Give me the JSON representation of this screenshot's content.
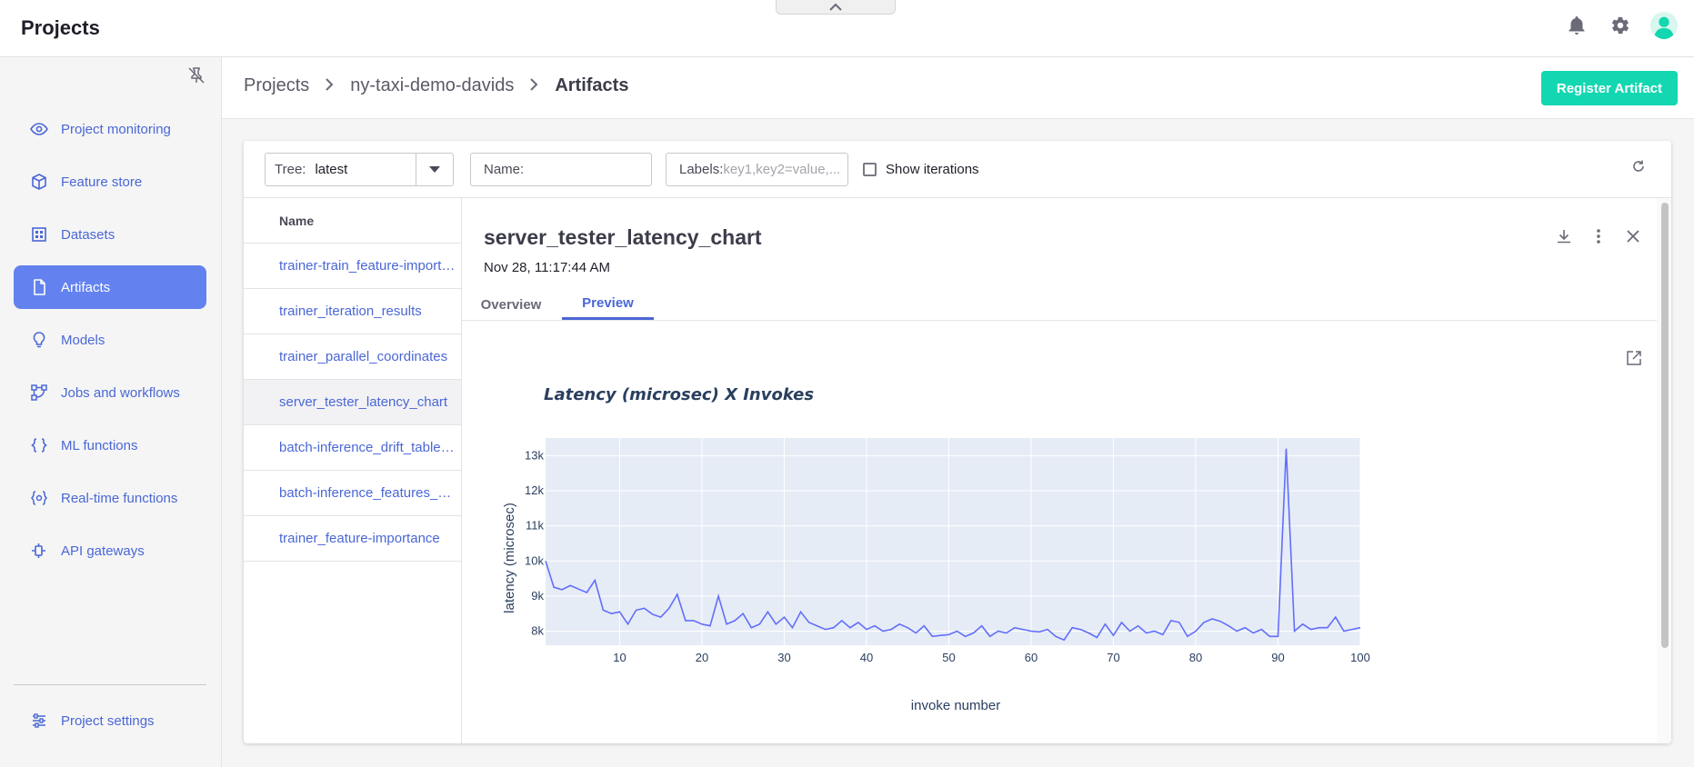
{
  "app": {
    "title": "Projects"
  },
  "sidebar": {
    "items": [
      {
        "label": "Project monitoring",
        "icon": "eye-icon",
        "active": false
      },
      {
        "label": "Feature store",
        "icon": "box-icon",
        "active": false
      },
      {
        "label": "Datasets",
        "icon": "grid-icon",
        "active": false
      },
      {
        "label": "Artifacts",
        "icon": "file-icon",
        "active": true
      },
      {
        "label": "Models",
        "icon": "bulb-icon",
        "active": false
      },
      {
        "label": "Jobs and workflows",
        "icon": "workflow-icon",
        "active": false
      },
      {
        "label": "ML functions",
        "icon": "braces-icon",
        "active": false
      },
      {
        "label": "Real-time functions",
        "icon": "realtime-icon",
        "active": false
      },
      {
        "label": "API gateways",
        "icon": "api-icon",
        "active": false
      }
    ],
    "settings_label": "Project settings"
  },
  "breadcrumb": [
    "Projects",
    "ny-taxi-demo-davids",
    "Artifacts"
  ],
  "header": {
    "register_label": "Register Artifact"
  },
  "filters": {
    "tree_label": "Tree:",
    "tree_value": "latest",
    "name_label": "Name:",
    "labels_label": "Labels:",
    "labels_placeholder": "key1,key2=value,...",
    "show_iterations": "Show iterations"
  },
  "list": {
    "header": "Name",
    "rows": [
      "trainer-train_feature-importance",
      "trainer_iteration_results",
      "trainer_parallel_coordinates",
      "server_tester_latency_chart",
      "batch-inference_drift_table_plot",
      "batch-inference_features_drift",
      "trainer_feature-importance"
    ],
    "selected": 3
  },
  "detail": {
    "title": "server_tester_latency_chart",
    "date": "Nov 28, 11:17:44 AM",
    "tabs": [
      "Overview",
      "Preview"
    ],
    "active_tab": "Preview"
  },
  "colors": {
    "accent": "#4a67d6",
    "register": "#13d7b0",
    "line": "#636efa",
    "plot_bg": "#e5ecf6"
  },
  "chart_data": {
    "type": "line",
    "title": "Latency (microsec) X  Invokes",
    "xlabel": "invoke number",
    "ylabel": "latency (microsec)",
    "xlim": [
      1,
      100
    ],
    "ylim": [
      7600,
      13500
    ],
    "x_ticks": [
      10,
      20,
      30,
      40,
      50,
      60,
      70,
      80,
      90,
      100
    ],
    "y_ticks": [
      8000,
      9000,
      10000,
      11000,
      12000,
      13000
    ],
    "y_tick_labels": [
      "8k",
      "9k",
      "10k",
      "11k",
      "12k",
      "13k"
    ],
    "grid": true,
    "series": [
      {
        "x": [
          1,
          2,
          3,
          4,
          5,
          6,
          7,
          8,
          9,
          10,
          11,
          12,
          13,
          14,
          15,
          16,
          17,
          18,
          19,
          20,
          21,
          22,
          23,
          24,
          25,
          26,
          27,
          28,
          29,
          30,
          31,
          32,
          33,
          34,
          35,
          36,
          37,
          38,
          39,
          40,
          41,
          42,
          43,
          44,
          45,
          46,
          47,
          48,
          49,
          50,
          51,
          52,
          53,
          54,
          55,
          56,
          57,
          58,
          59,
          60,
          61,
          62,
          63,
          64,
          65,
          66,
          67,
          68,
          69,
          70,
          71,
          72,
          73,
          74,
          75,
          76,
          77,
          78,
          79,
          80,
          81,
          82,
          83,
          84,
          85,
          86,
          87,
          88,
          89,
          90,
          91,
          92,
          93,
          94,
          95,
          96,
          97,
          98,
          99,
          100
        ],
        "values": [
          10000,
          9250,
          9180,
          9300,
          9200,
          9100,
          9450,
          8600,
          8500,
          8550,
          8200,
          8600,
          8650,
          8480,
          8400,
          8650,
          9050,
          8300,
          8300,
          8200,
          8150,
          9000,
          8200,
          8300,
          8500,
          8100,
          8200,
          8550,
          8200,
          8400,
          8100,
          8550,
          8250,
          8150,
          8050,
          8100,
          8300,
          8100,
          8250,
          8050,
          8150,
          8000,
          8050,
          8200,
          8100,
          7950,
          8150,
          7850,
          7880,
          7900,
          8000,
          7850,
          7950,
          8150,
          7850,
          8000,
          7950,
          8100,
          8050,
          8000,
          7980,
          8050,
          7850,
          7750,
          8100,
          8050,
          7950,
          7820,
          8200,
          7880,
          8250,
          8000,
          8150,
          7950,
          8000,
          7900,
          8300,
          8250,
          7850,
          8000,
          8250,
          8350,
          8280,
          8150,
          8000,
          8100,
          7950,
          8050,
          7850,
          7850,
          13200,
          8000,
          8200,
          8050,
          8100,
          8100,
          8400,
          8000,
          8050,
          8100
        ]
      }
    ]
  }
}
